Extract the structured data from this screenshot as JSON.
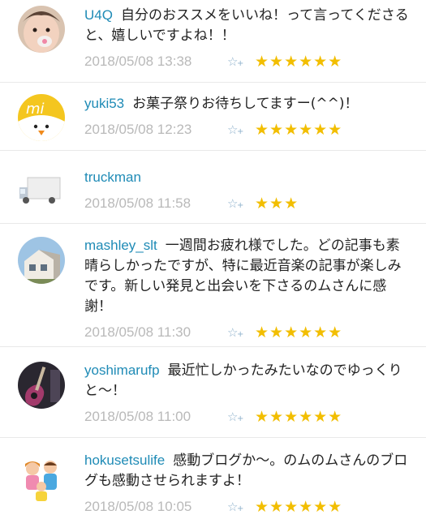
{
  "theme": {
    "username_color": "#1f8bb6",
    "date_color": "#b9b9b9",
    "star_color": "#f2be00",
    "add_star_color": "#8fb2cc"
  },
  "add_star_icon": "star-plus-icon",
  "comments": [
    {
      "user": "U4Q",
      "text": "自分のおススメをいいね！って言ってくださると、嬉しいですよね！！",
      "date": "2018/05/08 13:38",
      "stars": "★★★★★★",
      "avatar_icon": "baby-avatar"
    },
    {
      "user": "yuki53",
      "text": "お菓子祭りお待ちしてますー(^^)！",
      "date": "2018/05/08 12:23",
      "stars": "★★★★★★",
      "avatar_icon": "chick-avatar"
    },
    {
      "user": "truckman",
      "text": "",
      "date": "2018/05/08 11:58",
      "stars": "★★★",
      "avatar_icon": "truck-avatar"
    },
    {
      "user": "mashley_slt",
      "text": "一週間お疲れ様でした。どの記事も素晴らしかったですが、特に最近音楽の記事が楽しみです。新しい発見と出会いを下さるのムさんに感謝！",
      "date": "2018/05/08 11:30",
      "stars": "★★★★★★",
      "avatar_icon": "house-avatar"
    },
    {
      "user": "yoshimarufp",
      "text": "最近忙しかったみたいなのでゆっくりと～！",
      "date": "2018/05/08 11:00",
      "stars": "★★★★★★",
      "avatar_icon": "guitar-avatar"
    },
    {
      "user": "hokusetsulife",
      "text": "感動ブログか～。のムのムさんのブログも感動させられますよ！",
      "date": "2018/05/08 10:05",
      "stars": "★★★★★★",
      "avatar_icon": "family-avatar"
    }
  ]
}
